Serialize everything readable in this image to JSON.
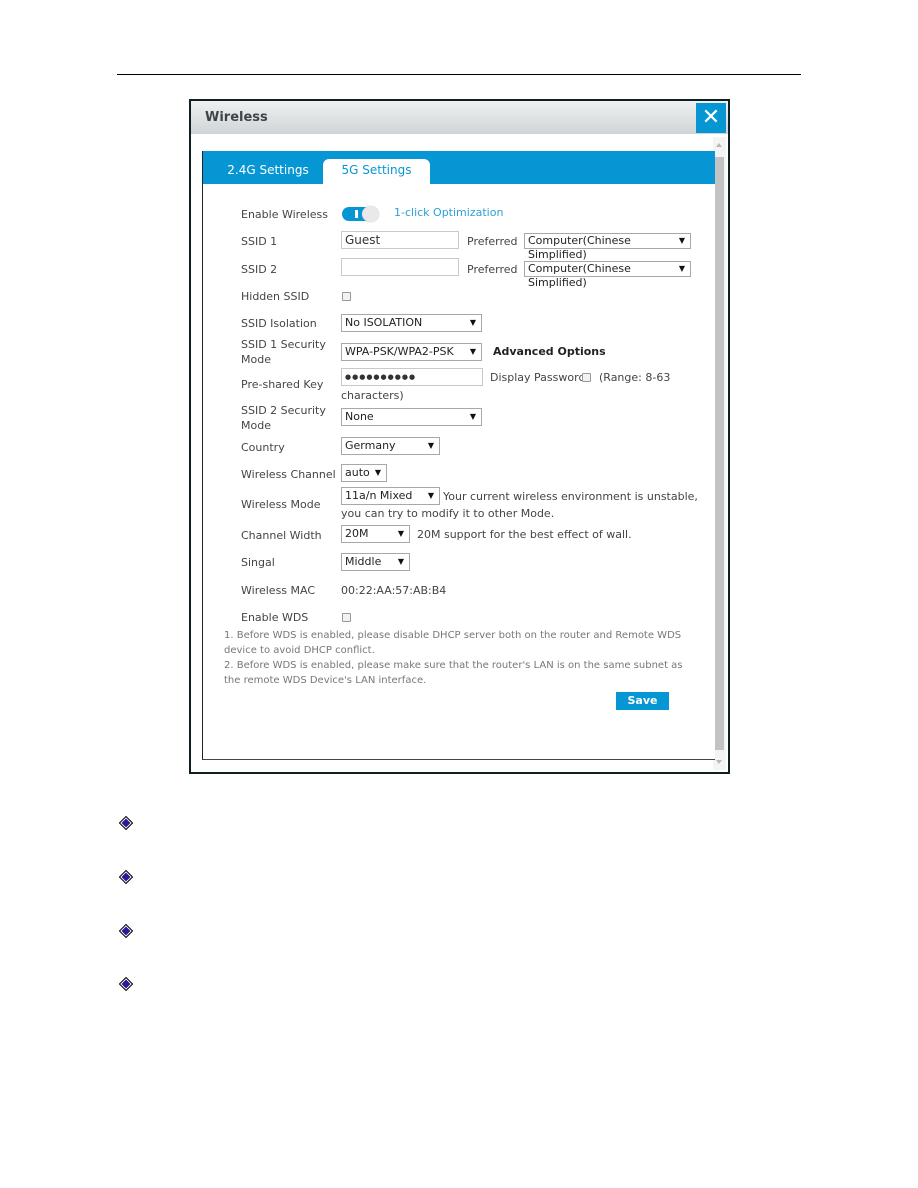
{
  "dialog": {
    "title": "Wireless",
    "close_icon": "✕",
    "tabs": [
      {
        "label": "2.4G Settings",
        "active": false
      },
      {
        "label": "5G Settings",
        "active": true
      }
    ]
  },
  "form": {
    "enable_wireless": {
      "label": "Enable Wireless",
      "on": true,
      "optimization_link": "1-click Optimization"
    },
    "ssid1": {
      "label": "SSID 1",
      "value": "Guest",
      "preferred_label": "Preferred",
      "preferred_value": "Computer(Chinese Simplified)"
    },
    "ssid2": {
      "label": "SSID 2",
      "value": "",
      "preferred_label": "Preferred",
      "preferred_value": "Computer(Chinese Simplified)"
    },
    "hidden_ssid": {
      "label": "Hidden SSID",
      "checked": false
    },
    "ssid_isolation": {
      "label": "SSID Isolation",
      "value": "No ISOLATION"
    },
    "ssid1_security": {
      "label_line1": "SSID 1 Security",
      "label_line2": "Mode",
      "value": "WPA-PSK/WPA2-PSK",
      "advanced": "Advanced Options"
    },
    "psk": {
      "label": "Pre-shared Key",
      "value": "●●●●●●●●●●",
      "display_password": "Display Password",
      "display_checked": false,
      "range_line1": "(Range: 8-63",
      "range_line2": "characters)"
    },
    "ssid2_security": {
      "label_line1": "SSID 2 Security",
      "label_line2": "Mode",
      "value": "None"
    },
    "country": {
      "label": "Country",
      "value": "Germany"
    },
    "channel": {
      "label": "Wireless Channel",
      "value": "auto"
    },
    "mode": {
      "label": "Wireless Mode",
      "value": "11a/n Mixed",
      "hint_line1": "Your current wireless environment is unstable,",
      "hint_line2": "you can try to modify it to other Mode."
    },
    "width": {
      "label": "Channel Width",
      "value": "20M",
      "hint": "20M support for the best effect of wall."
    },
    "signal": {
      "label": "Singal",
      "value": "Middle"
    },
    "mac": {
      "label": "Wireless MAC",
      "value": "00:22:AA:57:AB:B4"
    },
    "wds": {
      "label": "Enable WDS",
      "checked": false
    },
    "notes": [
      "1. Before WDS is enabled, please disable DHCP server both on the router and Remote WDS device to avoid DHCP conflict.",
      "2. Before WDS is enabled, please make sure that the router's LAN is on the same subnet as the remote WDS Device's LAN interface."
    ],
    "save_label": "Save",
    "dropdown_arrow": "▼"
  },
  "colors": {
    "accent": "#0796d4",
    "bullet": "#2a1a9a"
  },
  "bullets": [
    "diamond-icon",
    "diamond-icon",
    "diamond-icon",
    "diamond-icon"
  ]
}
